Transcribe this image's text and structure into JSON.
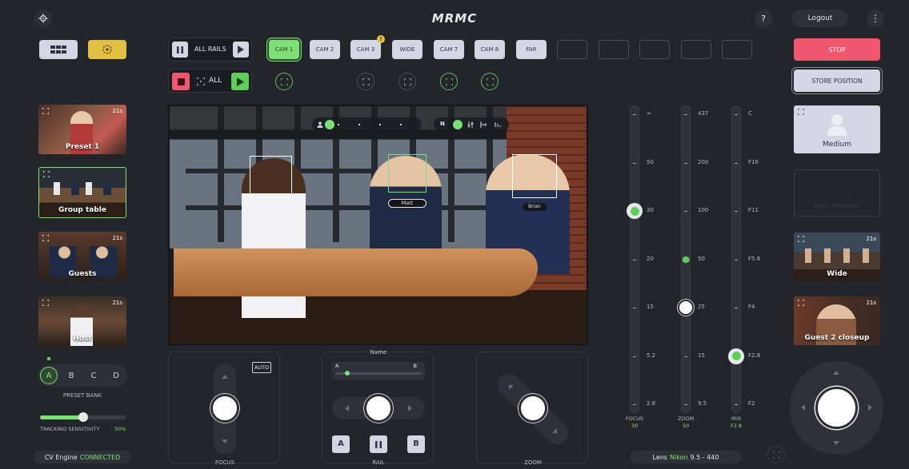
{
  "header": {
    "title": "MRMC",
    "help": "?",
    "logout": "Logout",
    "more": "⋮"
  },
  "toolbar": {
    "all_rails": "ALL RAILS",
    "all": "ALL",
    "cams": [
      "CAM 1",
      "CAM 2",
      "CAM 3",
      "WIDE",
      "CAM 7",
      "CAM 8",
      "FAR"
    ],
    "warning_badge": "!"
  },
  "right_panel": {
    "stop": "STOP",
    "store_position": "STORE POSITION",
    "presets": [
      {
        "label": "Medium"
      },
      {
        "label": "NOT STORED"
      },
      {
        "label": "Wide",
        "duration": "21s"
      },
      {
        "label": "Guest 2 closeup",
        "duration": "21s"
      }
    ]
  },
  "left_presets": [
    {
      "label": "Preset 1",
      "duration": "21s"
    },
    {
      "label": "Group table"
    },
    {
      "label": "Guests",
      "duration": "21s"
    },
    {
      "label": "Host",
      "duration": "21s"
    }
  ],
  "preset_bank": {
    "label": "PRESET BANK",
    "options": [
      "A",
      "B",
      "C",
      "D"
    ],
    "selected": "A"
  },
  "tracking": {
    "label": "TRACKING SENSITIVITY",
    "value": "50%",
    "level": 0.5
  },
  "cv_engine": {
    "label": "CV Engine",
    "status": "CONNECTED"
  },
  "video": {
    "overlay_toolbar": {
      "n_label": "N"
    },
    "faces": [
      {
        "name": "Matt"
      },
      {
        "name": "Brian"
      }
    ]
  },
  "focus_panel": {
    "label": "FOCUS",
    "auto": "AUTO"
  },
  "rail_panel": {
    "label": "RAIL",
    "name_label": "Name",
    "a": "A",
    "b": "B",
    "btn_a": "A",
    "btn_b": "B"
  },
  "zoom_panel": {
    "label": "ZOOM"
  },
  "lens_sliders": {
    "focus": {
      "label": "FOCUS",
      "value": "30",
      "ticks": [
        "∞",
        "50",
        "30",
        "20",
        "15",
        "5.2",
        "2.8"
      ]
    },
    "zoom": {
      "label": "ZOOM",
      "value": "50",
      "ticks": [
        "437",
        "200",
        "100",
        "50",
        "25",
        "15",
        "9.5"
      ]
    },
    "iris": {
      "label": "IRIS",
      "value": "F2.8",
      "ticks": [
        "C",
        "F16",
        "F11",
        "F5.6",
        "F4",
        "F2.8",
        "F2"
      ]
    }
  },
  "lens": {
    "prefix": "Lens",
    "brand": "Nikon",
    "range": "9.5 - 440"
  },
  "colors": {
    "accent_green": "#7fe07a",
    "stop_red": "#f0566e",
    "gold": "#e2c043",
    "background": "#23252b"
  }
}
